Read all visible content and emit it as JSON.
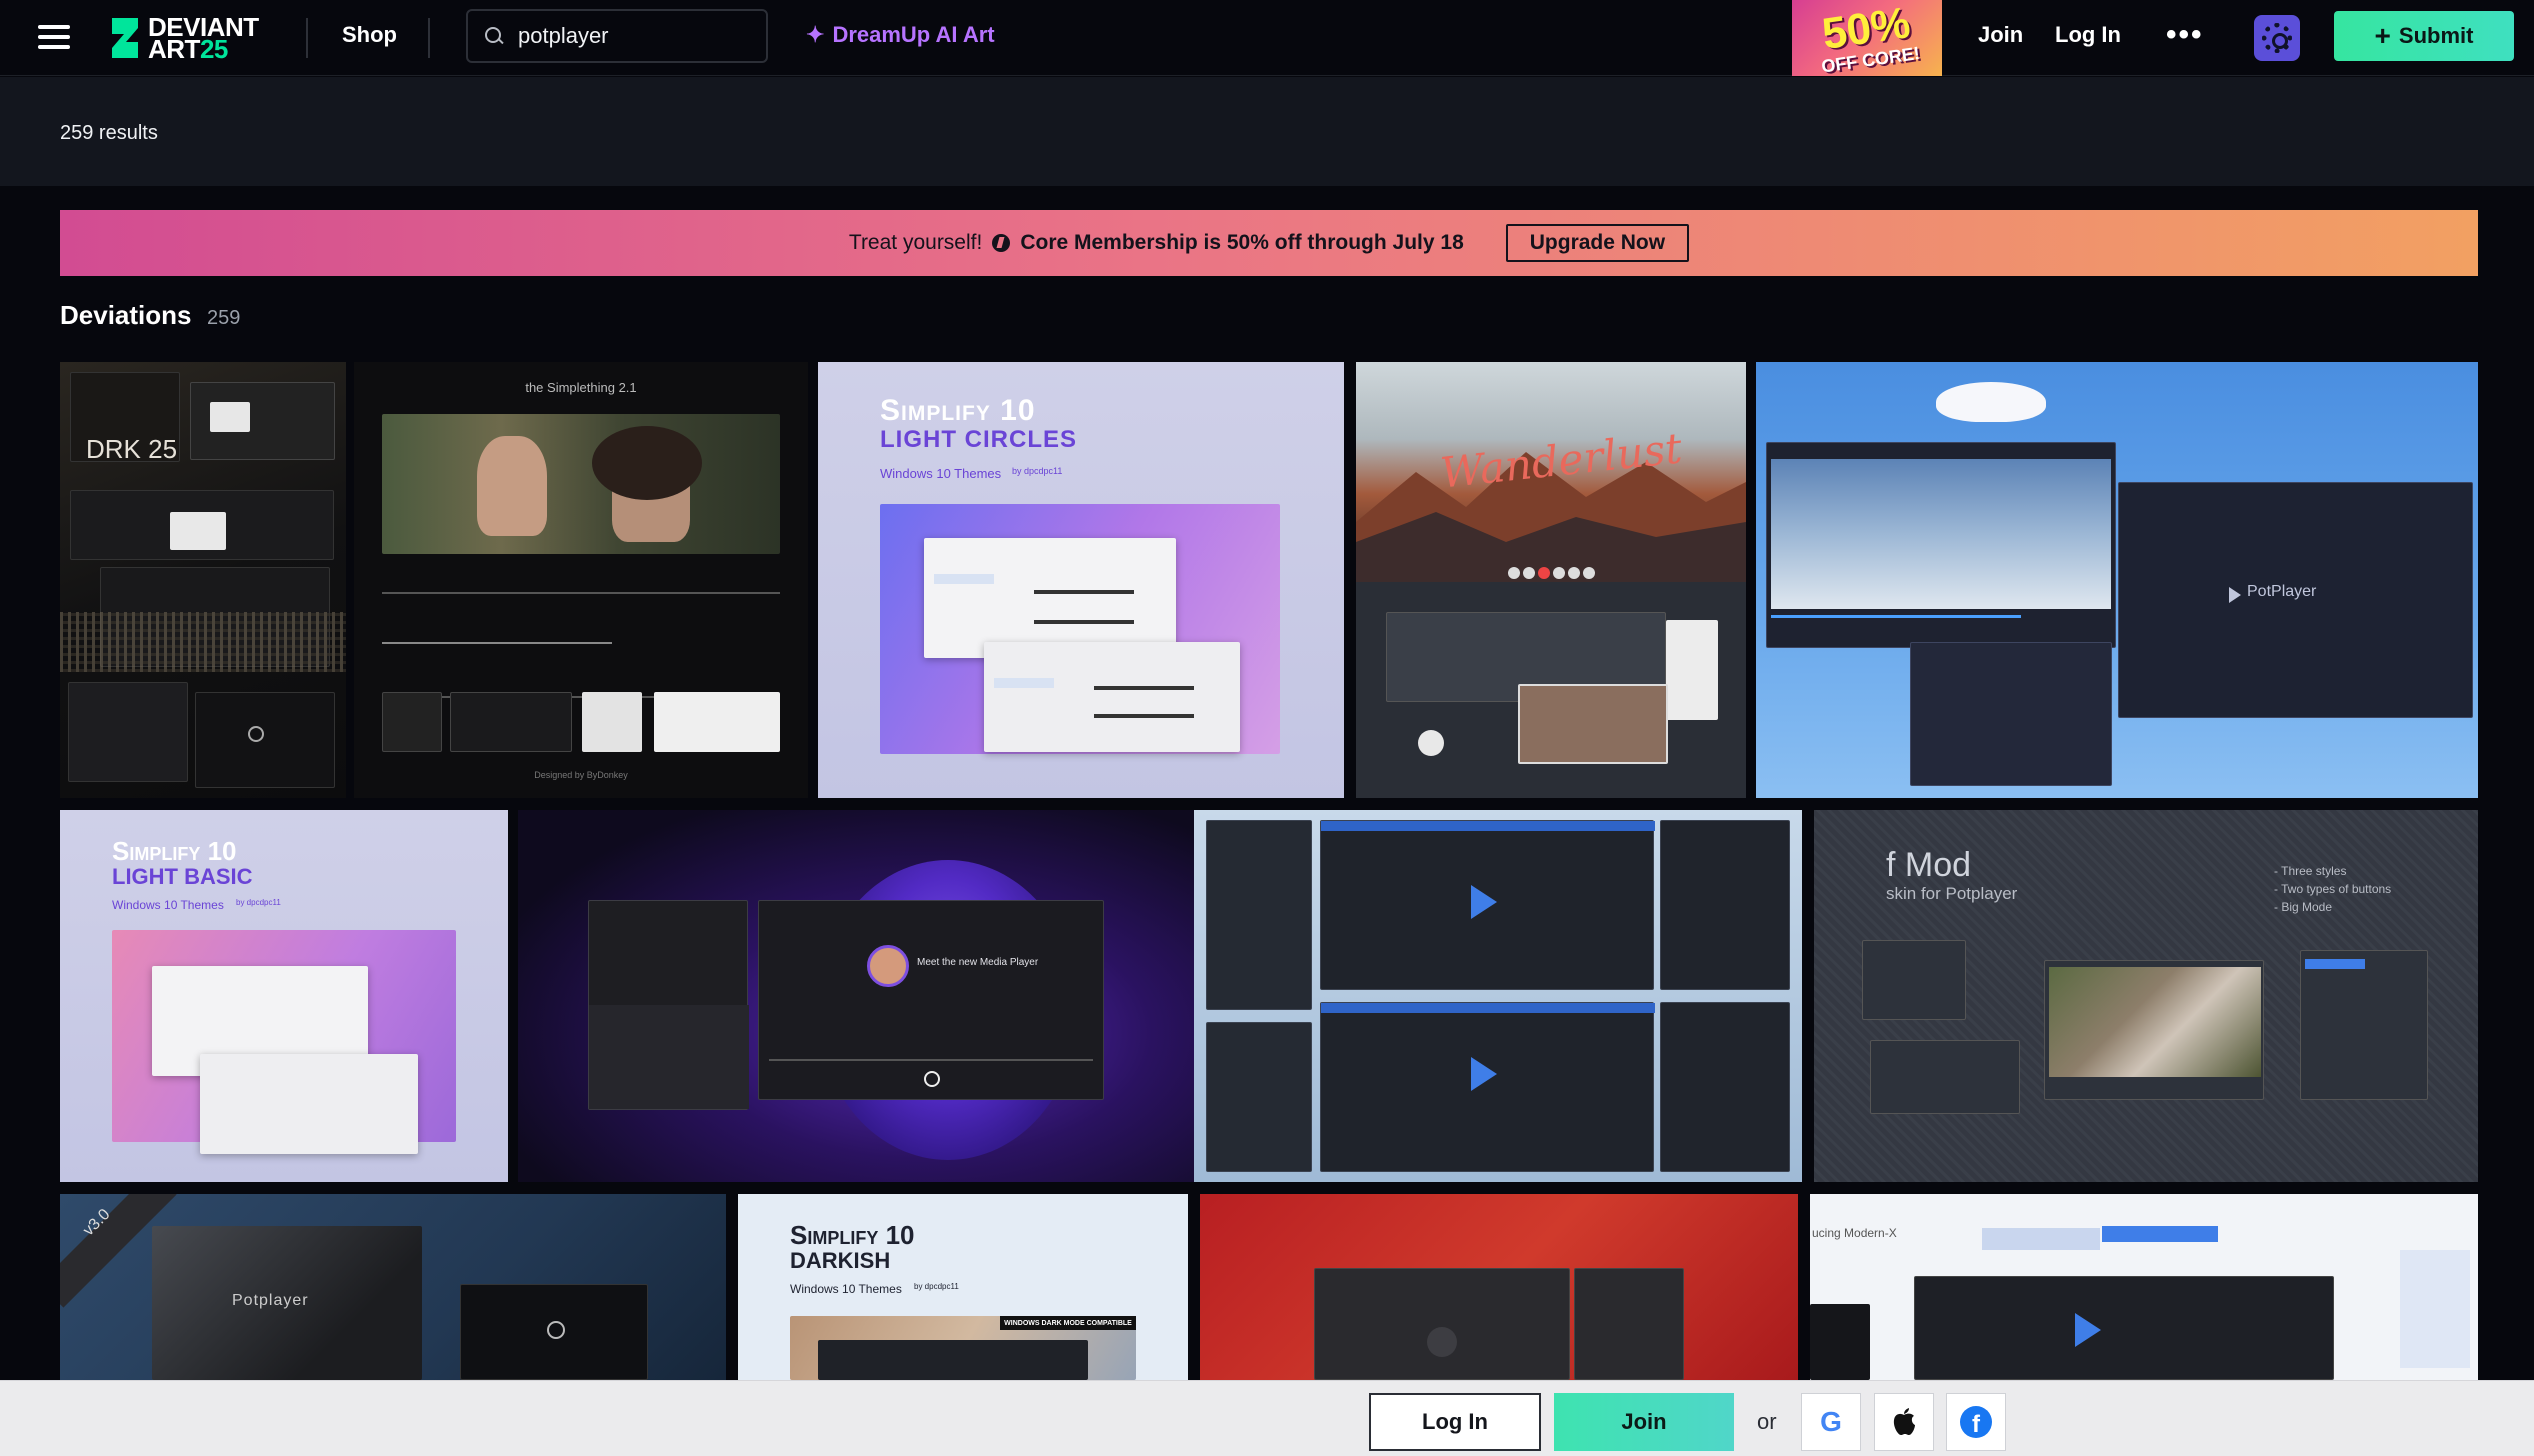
{
  "header": {
    "logo_line1": "DEVIANT",
    "logo_line2_art": "ART",
    "logo_line2_num": "25",
    "shop_label": "Shop",
    "search_value": "potplayer",
    "dreamup_label": "DreamUp AI Art",
    "promo_big": "50%",
    "promo_small": "OFF CORE!",
    "join_label": "Join",
    "login_label": "Log In",
    "more_label": "•••",
    "submit_label": "Submit"
  },
  "results": {
    "count_text": "259 results"
  },
  "banner": {
    "lead": "Treat yourself!",
    "offer": "Core Membership is 50% off through July 18",
    "button_label": "Upgrade Now"
  },
  "section": {
    "title": "Deviations",
    "count": "259"
  },
  "thumbs": {
    "t1_label": "DRK 25",
    "t2_title": "the Simplething 2.1",
    "t2_caption": "Designed by ByDonkey",
    "t3_title1": "Simplify 10",
    "t3_title2": "Light Circles",
    "t3_sub": "Windows 10 Themes",
    "t3_by": "by dpcdpc11",
    "t4_script": "Wanderlust",
    "t5_title": "PotPlayer",
    "t6_title1": "Simplify 10",
    "t6_title2": "Light Basic",
    "t6_sub": "Windows 10 Themes",
    "t6_by": "by dpcdpc11",
    "t7_caption": "Meet the new Media Player",
    "t9_title": "f Mod",
    "t9_sub": "skin for Potplayer",
    "t9_bullets": [
      "- Three styles",
      "- Two types of buttons",
      "- Big Mode"
    ],
    "t10_ribbon": "v3.0",
    "t10_title": "Potplayer",
    "t11_title1": "Simplify 10",
    "t11_title2": "Darkish",
    "t11_sub": "Windows 10 Themes",
    "t11_by": "by dpcdpc11",
    "t11_badge": "WINDOWS DARK MODE COMPATIBLE",
    "t13_text": "ucing Modern-X"
  },
  "bottom_bar": {
    "login_label": "Log In",
    "join_label": "Join",
    "or_label": "or",
    "google_glyph": "G",
    "apple_glyph": "",
    "facebook_glyph": "f"
  },
  "colors": {
    "accent_green": "#00e59b",
    "dreamup_purple": "#b673ff",
    "settings_purple": "#5b4fd9"
  }
}
